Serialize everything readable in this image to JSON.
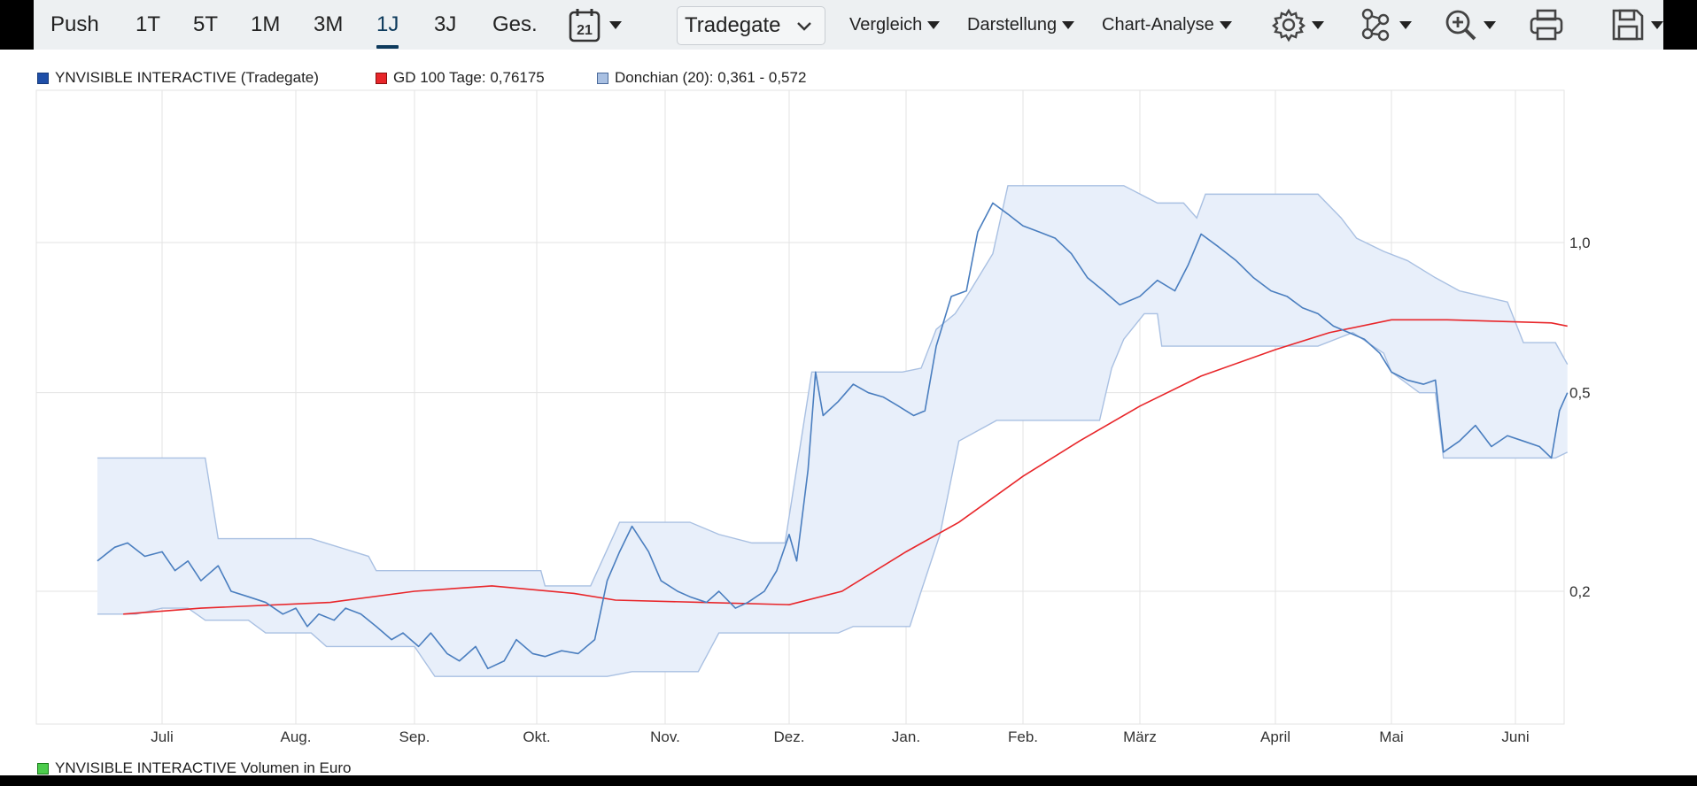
{
  "toolbar": {
    "periods": [
      "Push",
      "1T",
      "5T",
      "1M",
      "3M",
      "1J",
      "3J",
      "Ges."
    ],
    "active_period": "1J",
    "calendar_day": "21",
    "exchange_select": "Tradegate",
    "menus": [
      "Vergleich",
      "Darstellung",
      "Chart-Analyse"
    ],
    "icons": [
      "gear-icon",
      "network-icon",
      "zoom-in-icon",
      "print-icon",
      "save-icon"
    ]
  },
  "legend": {
    "price_label": "YNVISIBLE INTERACTIVE (Tradegate)",
    "ma_label": "GD 100 Tage: 0,76175",
    "donchian_label": "Donchian (20): 0,361 - 0,572",
    "volume_label": "YNVISIBLE INTERACTIVE Volumen in Euro"
  },
  "colors": {
    "price": "#4a7ebf",
    "price_legend": "#1f4fa8",
    "ma": "#e8262a",
    "band_fill": "#e8effa",
    "band_line": "#a9c0e2",
    "volume": "#4ccc4c",
    "grid": "#e3e3e3",
    "active_period": "#0d3a5c"
  },
  "chart_data": {
    "type": "line",
    "scale": "log",
    "x_tick_labels": [
      "Juli",
      "Aug.",
      "Sep.",
      "Okt.",
      "Nov.",
      "Dez.",
      "Jan.",
      "Feb.",
      "März",
      "April",
      "Mai",
      "Juni"
    ],
    "y_tick_labels": [
      "1,0",
      "0,5",
      "0,2"
    ],
    "y_ticks": [
      1.0,
      0.5,
      0.2
    ],
    "ylim": [
      0.12,
      2.0
    ],
    "grid": true,
    "legend_position": "top-left",
    "series": [
      {
        "name": "YNVISIBLE INTERACTIVE (Tradegate)",
        "role": "price",
        "points": [
          [
            "06-16",
            0.23
          ],
          [
            "06-20",
            0.245
          ],
          [
            "06-23",
            0.25
          ],
          [
            "06-27",
            0.235
          ],
          [
            "07-01",
            0.24
          ],
          [
            "07-04",
            0.22
          ],
          [
            "07-07",
            0.23
          ],
          [
            "07-10",
            0.21
          ],
          [
            "07-14",
            0.225
          ],
          [
            "07-17",
            0.2
          ],
          [
            "07-21",
            0.195
          ],
          [
            "07-25",
            0.19
          ],
          [
            "07-29",
            0.18
          ],
          [
            "08-01",
            0.185
          ],
          [
            "08-04",
            0.17
          ],
          [
            "08-07",
            0.18
          ],
          [
            "08-11",
            0.175
          ],
          [
            "08-14",
            0.185
          ],
          [
            "08-18",
            0.18
          ],
          [
            "08-22",
            0.17
          ],
          [
            "08-26",
            0.16
          ],
          [
            "08-29",
            0.165
          ],
          [
            "09-02",
            0.155
          ],
          [
            "09-05",
            0.165
          ],
          [
            "09-09",
            0.15
          ],
          [
            "09-12",
            0.145
          ],
          [
            "09-16",
            0.155
          ],
          [
            "09-19",
            0.14
          ],
          [
            "09-23",
            0.145
          ],
          [
            "09-26",
            0.16
          ],
          [
            "09-30",
            0.15
          ],
          [
            "10-03",
            0.148
          ],
          [
            "10-07",
            0.152
          ],
          [
            "10-11",
            0.15
          ],
          [
            "10-15",
            0.16
          ],
          [
            "10-18",
            0.21
          ],
          [
            "10-21",
            0.24
          ],
          [
            "10-24",
            0.27
          ],
          [
            "10-28",
            0.24
          ],
          [
            "10-31",
            0.21
          ],
          [
            "11-04",
            0.2
          ],
          [
            "11-07",
            0.195
          ],
          [
            "11-11",
            0.19
          ],
          [
            "11-14",
            0.2
          ],
          [
            "11-18",
            0.185
          ],
          [
            "11-21",
            0.19
          ],
          [
            "11-25",
            0.2
          ],
          [
            "11-28",
            0.22
          ],
          [
            "12-01",
            0.26
          ],
          [
            "12-03",
            0.23
          ],
          [
            "12-06",
            0.35
          ],
          [
            "12-08",
            0.55
          ],
          [
            "12-10",
            0.45
          ],
          [
            "12-14",
            0.48
          ],
          [
            "12-18",
            0.52
          ],
          [
            "12-22",
            0.5
          ],
          [
            "12-26",
            0.49
          ],
          [
            "12-30",
            0.47
          ],
          [
            "01-03",
            0.45
          ],
          [
            "01-06",
            0.46
          ],
          [
            "01-09",
            0.62
          ],
          [
            "01-13",
            0.78
          ],
          [
            "01-17",
            0.8
          ],
          [
            "01-20",
            1.05
          ],
          [
            "01-24",
            1.2
          ],
          [
            "01-28",
            1.14
          ],
          [
            "02-01",
            1.08
          ],
          [
            "02-05",
            1.05
          ],
          [
            "02-09",
            1.02
          ],
          [
            "02-13",
            0.95
          ],
          [
            "02-17",
            0.85
          ],
          [
            "02-21",
            0.8
          ],
          [
            "02-25",
            0.75
          ],
          [
            "03-01",
            0.78
          ],
          [
            "03-05",
            0.84
          ],
          [
            "03-09",
            0.8
          ],
          [
            "03-12",
            0.9
          ],
          [
            "03-15",
            1.04
          ],
          [
            "03-19",
            0.98
          ],
          [
            "03-23",
            0.92
          ],
          [
            "03-27",
            0.85
          ],
          [
            "03-31",
            0.8
          ],
          [
            "04-04",
            0.78
          ],
          [
            "04-08",
            0.74
          ],
          [
            "04-12",
            0.72
          ],
          [
            "04-16",
            0.68
          ],
          [
            "04-20",
            0.66
          ],
          [
            "04-24",
            0.64
          ],
          [
            "04-28",
            0.6
          ],
          [
            "05-01",
            0.55
          ],
          [
            "05-05",
            0.53
          ],
          [
            "05-09",
            0.52
          ],
          [
            "05-12",
            0.53
          ],
          [
            "05-14",
            0.38
          ],
          [
            "05-18",
            0.4
          ],
          [
            "05-22",
            0.43
          ],
          [
            "05-26",
            0.39
          ],
          [
            "05-30",
            0.41
          ],
          [
            "06-03",
            0.4
          ],
          [
            "06-07",
            0.39
          ],
          [
            "06-10",
            0.37
          ],
          [
            "06-12",
            0.46
          ],
          [
            "06-14",
            0.5
          ]
        ]
      },
      {
        "name": "GD 100 Tage",
        "role": "ma",
        "points": [
          [
            "06-22",
            0.18
          ],
          [
            "07-10",
            0.185
          ],
          [
            "08-10",
            0.19
          ],
          [
            "09-01",
            0.2
          ],
          [
            "09-20",
            0.205
          ],
          [
            "10-10",
            0.198
          ],
          [
            "10-20",
            0.192
          ],
          [
            "11-10",
            0.19
          ],
          [
            "12-01",
            0.188
          ],
          [
            "12-15",
            0.2
          ],
          [
            "01-01",
            0.24
          ],
          [
            "01-15",
            0.275
          ],
          [
            "02-01",
            0.34
          ],
          [
            "02-15",
            0.4
          ],
          [
            "03-01",
            0.47
          ],
          [
            "03-15",
            0.54
          ],
          [
            "04-01",
            0.61
          ],
          [
            "04-15",
            0.66
          ],
          [
            "05-01",
            0.7
          ],
          [
            "05-15",
            0.7
          ],
          [
            "06-10",
            0.69
          ],
          [
            "06-14",
            0.68
          ]
        ]
      },
      {
        "name": "Donchian (20)",
        "role": "band",
        "upper": [
          [
            "06-16",
            0.37
          ],
          [
            "07-11",
            0.37
          ],
          [
            "07-14",
            0.255
          ],
          [
            "08-05",
            0.255
          ],
          [
            "08-20",
            0.235
          ],
          [
            "08-22",
            0.22
          ],
          [
            "09-05",
            0.22
          ],
          [
            "09-08",
            0.22
          ],
          [
            "10-02",
            0.22
          ],
          [
            "10-03",
            0.205
          ],
          [
            "10-14",
            0.205
          ],
          [
            "10-21",
            0.275
          ],
          [
            "11-07",
            0.275
          ],
          [
            "11-14",
            0.26
          ],
          [
            "11-22",
            0.25
          ],
          [
            "11-30",
            0.25
          ],
          [
            "12-07",
            0.55
          ],
          [
            "12-31",
            0.55
          ],
          [
            "01-05",
            0.56
          ],
          [
            "01-09",
            0.67
          ],
          [
            "01-14",
            0.72
          ],
          [
            "01-18",
            0.8
          ],
          [
            "01-24",
            0.95
          ],
          [
            "01-28",
            1.3
          ],
          [
            "02-26",
            1.3
          ],
          [
            "03-05",
            1.2
          ],
          [
            "03-11",
            1.2
          ],
          [
            "03-14",
            1.12
          ],
          [
            "03-16",
            1.25
          ],
          [
            "04-12",
            1.25
          ],
          [
            "04-18",
            1.12
          ],
          [
            "04-22",
            1.02
          ],
          [
            "04-29",
            0.96
          ],
          [
            "05-05",
            0.92
          ],
          [
            "05-12",
            0.85
          ],
          [
            "05-18",
            0.8
          ],
          [
            "05-30",
            0.76
          ],
          [
            "06-03",
            0.63
          ],
          [
            "06-11",
            0.63
          ],
          [
            "06-14",
            0.57
          ]
        ],
        "lower": [
          [
            "06-16",
            0.18
          ],
          [
            "06-25",
            0.18
          ],
          [
            "07-01",
            0.185
          ],
          [
            "07-07",
            0.185
          ],
          [
            "07-11",
            0.175
          ],
          [
            "07-21",
            0.175
          ],
          [
            "07-25",
            0.165
          ],
          [
            "08-05",
            0.165
          ],
          [
            "08-09",
            0.155
          ],
          [
            "09-01",
            0.155
          ],
          [
            "09-06",
            0.135
          ],
          [
            "10-18",
            0.135
          ],
          [
            "10-24",
            0.138
          ],
          [
            "11-09",
            0.138
          ],
          [
            "11-14",
            0.165
          ],
          [
            "12-14",
            0.165
          ],
          [
            "12-18",
            0.17
          ],
          [
            "01-02",
            0.17
          ],
          [
            "01-05",
            0.2
          ],
          [
            "01-10",
            0.26
          ],
          [
            "01-15",
            0.4
          ],
          [
            "01-25",
            0.44
          ],
          [
            "02-20",
            0.44
          ],
          [
            "02-23",
            0.56
          ],
          [
            "02-26",
            0.64
          ],
          [
            "03-02",
            0.72
          ],
          [
            "03-05",
            0.72
          ],
          [
            "03-06",
            0.62
          ],
          [
            "04-12",
            0.62
          ],
          [
            "04-21",
            0.66
          ],
          [
            "04-29",
            0.6
          ],
          [
            "05-01",
            0.55
          ],
          [
            "05-08",
            0.5
          ],
          [
            "05-12",
            0.5
          ],
          [
            "05-14",
            0.37
          ],
          [
            "06-11",
            0.37
          ],
          [
            "06-14",
            0.38
          ]
        ]
      }
    ]
  }
}
